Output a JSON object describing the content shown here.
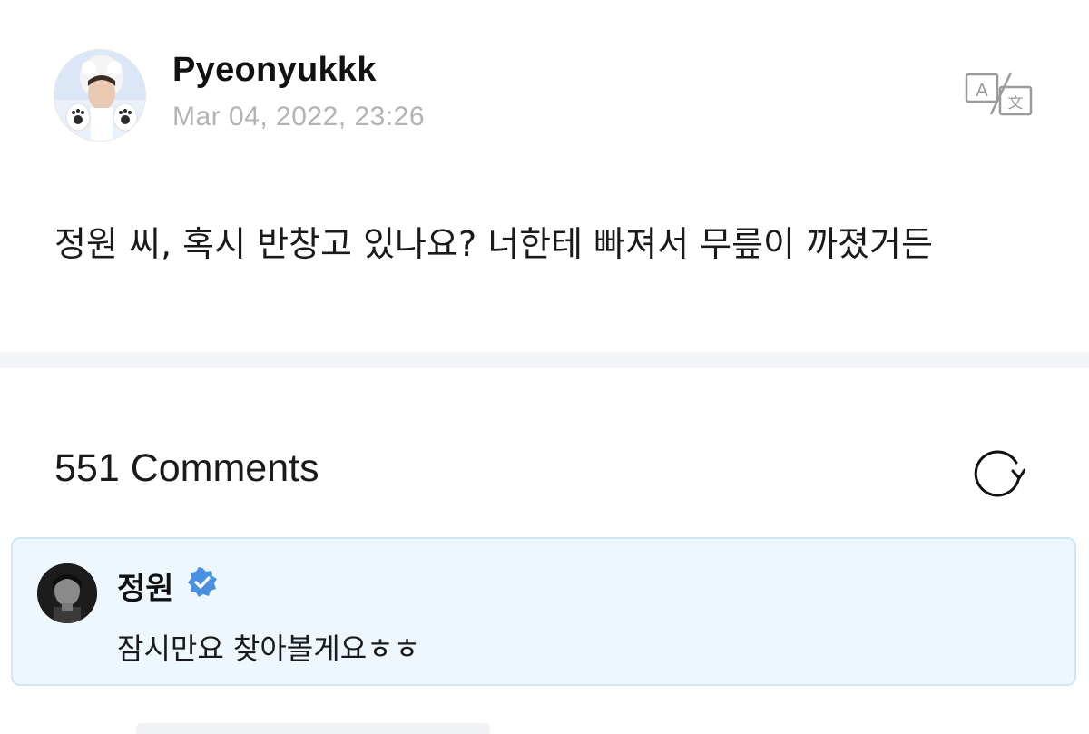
{
  "post": {
    "author": "Pyeonyukkk",
    "timestamp": "Mar 04, 2022, 23:26",
    "avatar_icon": "user-avatar-photo",
    "translate_icon": "translate-icon",
    "body": "정원 씨, 혹시 반창고 있나요? 너한테 빠져서 무릎이 까졌거든"
  },
  "comments": {
    "count_label": "551 Comments",
    "refresh_icon": "refresh-icon",
    "items": [
      {
        "author": "정원",
        "verified": true,
        "verified_color": "#4a90e2",
        "text": "잠시만요 찾아볼게요ㅎㅎ"
      }
    ]
  },
  "colors": {
    "highlight_bg": "#eef7fd",
    "highlight_border": "#cfe6f5",
    "timestamp": "#b3b3b3"
  }
}
